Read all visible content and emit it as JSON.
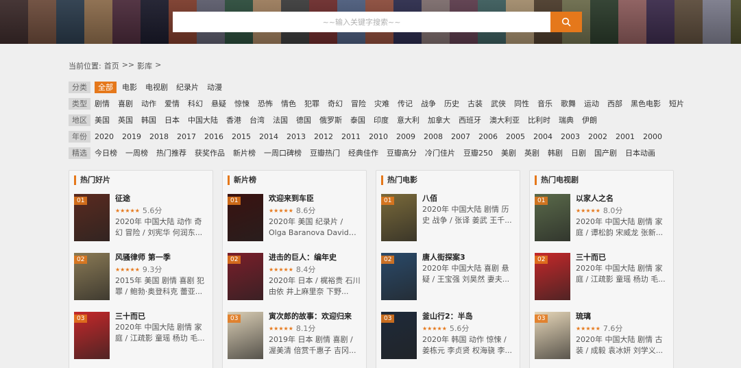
{
  "search": {
    "placeholder": "~~输入关键字搜索~~"
  },
  "breadcrumb": {
    "prefix": "当前位置:",
    "home": "首页",
    "sep1": ">>",
    "current": "影库",
    "sep2": ">"
  },
  "filters": [
    {
      "tag": "分类",
      "items": [
        "全部",
        "电影",
        "电视剧",
        "纪录片",
        "动漫"
      ],
      "active": 0
    },
    {
      "tag": "类型",
      "items": [
        "剧情",
        "喜剧",
        "动作",
        "爱情",
        "科幻",
        "悬疑",
        "惊悚",
        "恐怖",
        "情色",
        "犯罪",
        "奇幻",
        "冒险",
        "灾难",
        "传记",
        "战争",
        "历史",
        "古装",
        "武侠",
        "同性",
        "音乐",
        "歌舞",
        "运动",
        "西部",
        "黑色电影",
        "短片"
      ],
      "active": -1
    },
    {
      "tag": "地区",
      "items": [
        "美国",
        "英国",
        "韩国",
        "日本",
        "中国大陆",
        "香港",
        "台湾",
        "法国",
        "德国",
        "俄罗斯",
        "泰国",
        "印度",
        "意大利",
        "加拿大",
        "西班牙",
        "澳大利亚",
        "比利时",
        "瑞典",
        "伊朗"
      ],
      "active": -1
    },
    {
      "tag": "年份",
      "items": [
        "2020",
        "2019",
        "2018",
        "2017",
        "2016",
        "2015",
        "2014",
        "2013",
        "2012",
        "2011",
        "2010",
        "2009",
        "2008",
        "2007",
        "2006",
        "2005",
        "2004",
        "2003",
        "2002",
        "2001",
        "2000"
      ],
      "active": -1
    },
    {
      "tag": "精选",
      "items": [
        "今日榜",
        "一周榜",
        "热门推荐",
        "获奖作品",
        "新片榜",
        "一周口碑榜",
        "豆瓣热门",
        "经典佳作",
        "豆瓣高分",
        "冷门佳片",
        "豆瓣250",
        "美剧",
        "英剧",
        "韩剧",
        "日剧",
        "国产剧",
        "日本动画"
      ],
      "active": -1
    }
  ],
  "panels": [
    {
      "title": "热门好片",
      "items": [
        {
          "rank": "01",
          "title": "征途",
          "score": "5.6分",
          "meta": "2020年 中国大陆 动作 奇幻 冒险 / 刘宪华 何润东...",
          "color": "#5a2a1f"
        },
        {
          "rank": "02",
          "title": "风骚律师 第一季",
          "score": "9.3分",
          "meta": "2015年 美国 剧情 喜剧 犯罪 / 鲍勃·奥登科克 蕾亚...",
          "color": "#8a7a55"
        },
        {
          "rank": "03",
          "title": "三十而已",
          "score": "",
          "meta": "2020年 中国大陆 剧情 家庭 / 江疏影 童瑶 杨玏 毛...",
          "color": "#c5282a"
        }
      ]
    },
    {
      "title": "新片榜",
      "items": [
        {
          "rank": "01",
          "title": "欢迎来到车臣",
          "score": "8.6分",
          "meta": "2020年 美国 纪录片 / Olga Baranova David Istee...",
          "color": "#3a1210"
        },
        {
          "rank": "02",
          "title": "进击的巨人：编年史",
          "score": "8.4分",
          "meta": "2020年 日本 / 梶裕贵 石川由依 井上麻里奈 下野...",
          "color": "#7a1e2a"
        },
        {
          "rank": "03",
          "title": "寅次郎的故事：欢迎归来",
          "score": "8.1分",
          "meta": "2019年 日本 剧情 喜剧 / 渥美清 倍赏千惠子 吉冈...",
          "color": "#d9cdb4"
        }
      ]
    },
    {
      "title": "热门电影",
      "items": [
        {
          "rank": "01",
          "title": "八佰",
          "score": "",
          "meta": "2020年 中国大陆 剧情 历史 战争 / 张译 姜武 王千...",
          "color": "#7a6a3a"
        },
        {
          "rank": "02",
          "title": "唐人街探案3",
          "score": "",
          "meta": "2020年 中国大陆 喜剧 悬疑 / 王宝强 刘昊然 妻夫...",
          "color": "#2a4a6a"
        },
        {
          "rank": "03",
          "title": "釜山行2：半岛",
          "score": "5.6分",
          "meta": "2020年 韩国 动作 惊悚 / 姜栋元 李贞贤 权海骁 李...",
          "color": "#1e2a3a"
        }
      ]
    },
    {
      "title": "热门电视剧",
      "items": [
        {
          "rank": "01",
          "title": "以家人之名",
          "score": "8.0分",
          "meta": "2020年 中国大陆 剧情 家庭 / 谭松韵 宋威龙 张新...",
          "color": "#5a6a4a"
        },
        {
          "rank": "02",
          "title": "三十而已",
          "score": "",
          "meta": "2020年 中国大陆 剧情 家庭 / 江疏影 童瑶 杨玏 毛...",
          "color": "#c5282a"
        },
        {
          "rank": "03",
          "title": "琉璃",
          "score": "7.6分",
          "meta": "2020年 中国大陆 剧情 古装 / 成毅 袁冰妍 刘学义...",
          "color": "#e6d6b8"
        }
      ]
    }
  ],
  "icons": {
    "search": "search-icon",
    "stars": "★★★★★"
  }
}
